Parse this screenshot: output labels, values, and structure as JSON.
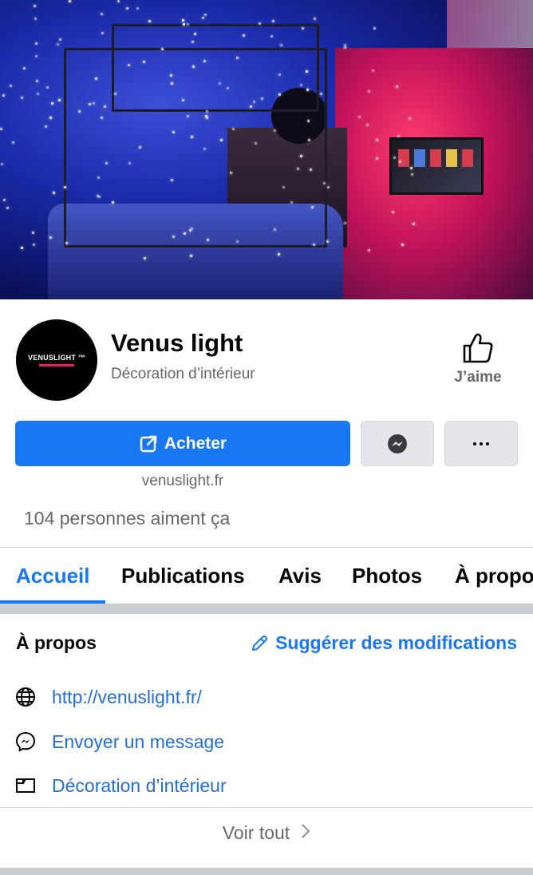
{
  "page": {
    "name": "Venus light",
    "category": "Décoration d’intérieur",
    "logo_text": "VENUSLIGHT ™",
    "like_label": "J’aime",
    "buy_label": "Acheter",
    "website_short": "venuslight.fr",
    "likes_text": "104 personnes aiment ça"
  },
  "tabs": [
    {
      "label": "Accueil",
      "active": true
    },
    {
      "label": "Publications"
    },
    {
      "label": "Avis"
    },
    {
      "label": "Photos"
    },
    {
      "label": "À propos"
    }
  ],
  "about": {
    "title": "À propos",
    "suggest_label": "Suggérer des modifications",
    "items": [
      {
        "icon": "globe-icon",
        "text": "http://venuslight.fr/"
      },
      {
        "icon": "messenger-icon",
        "text": "Envoyer un message"
      },
      {
        "icon": "category-icon",
        "text": "Décoration d’intérieur"
      }
    ],
    "see_all": "Voir tout"
  },
  "colors": {
    "accent": "#1877f2",
    "link": "#216fdb",
    "secondary_text": "#65676b"
  }
}
